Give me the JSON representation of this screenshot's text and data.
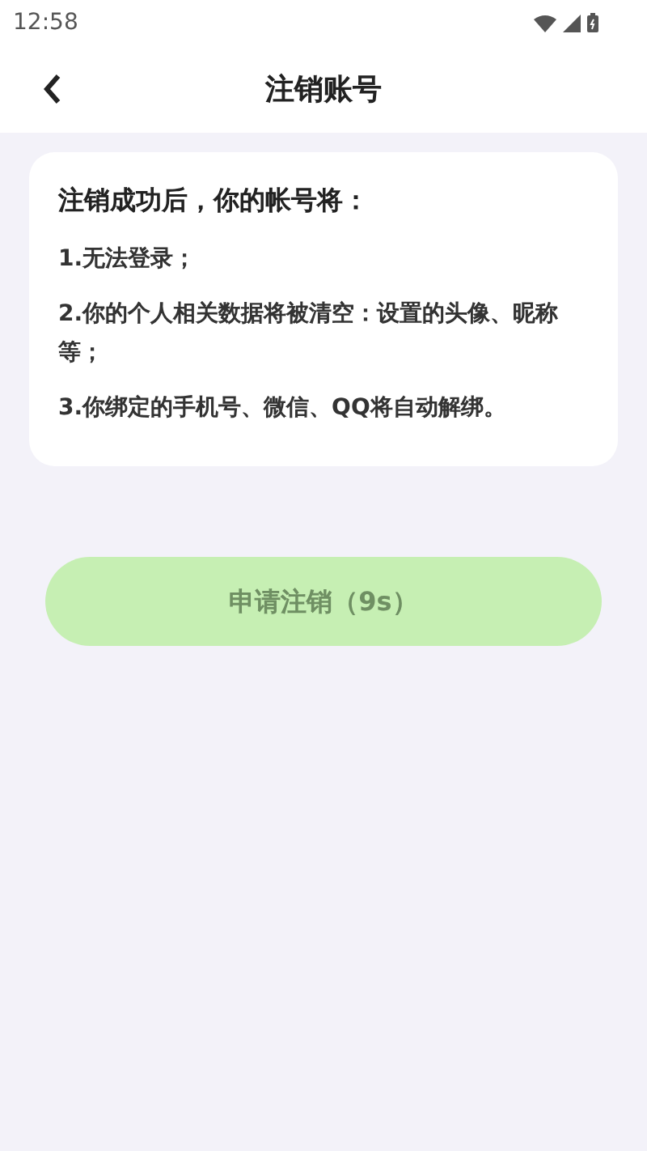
{
  "status_bar": {
    "time": "12:58"
  },
  "header": {
    "title": "注销账号"
  },
  "notice": {
    "title": "注销成功后，你的帐号将：",
    "items": [
      "1.无法登录；",
      "2.你的个人相关数据将被清空：设置的头像、昵称等；",
      "3.你绑定的手机号、微信、QQ将自动解绑。"
    ]
  },
  "apply_button": {
    "label": "申请注销（9s）",
    "disabled": true
  }
}
